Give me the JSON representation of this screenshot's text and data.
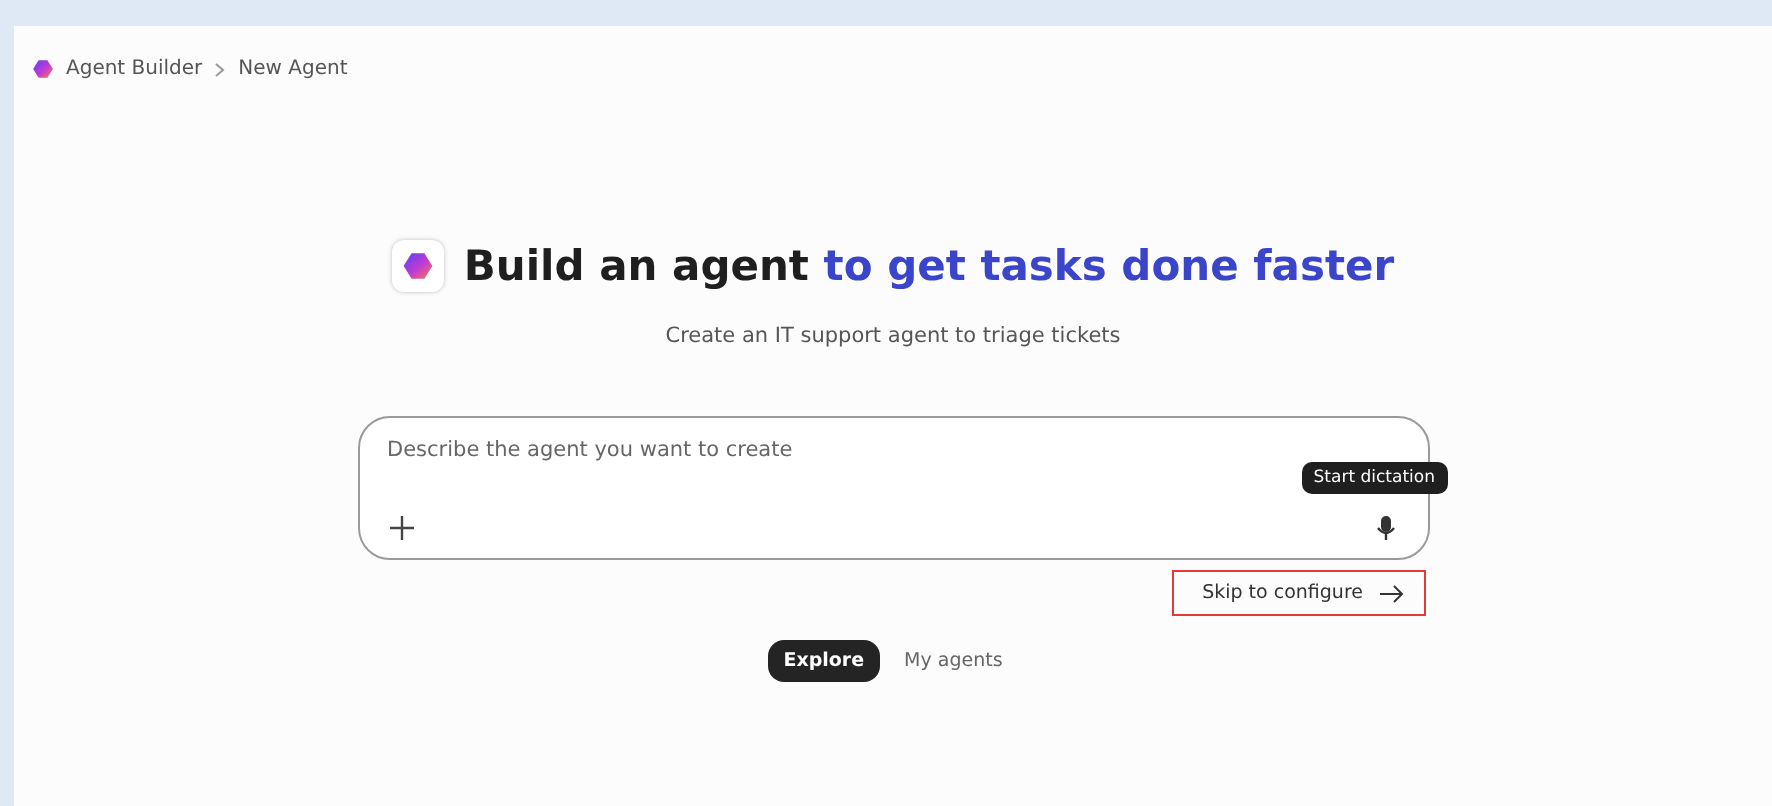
{
  "breadcrumb": [
    {
      "label": "Agent Builder"
    },
    {
      "label": "New Agent"
    }
  ],
  "heading": {
    "lead": "Build an agent",
    "accent": "to get tasks done faster"
  },
  "subtitle": "Create an IT support agent to triage tickets",
  "prompt": {
    "placeholder": "Describe the agent you want to create"
  },
  "tooltip": "Start dictation",
  "skip_button": {
    "label": "Skip to configure",
    "highlighted": true
  },
  "tabs": [
    {
      "label": "Explore",
      "selected": true
    },
    {
      "label": "My agents",
      "selected": false
    }
  ]
}
